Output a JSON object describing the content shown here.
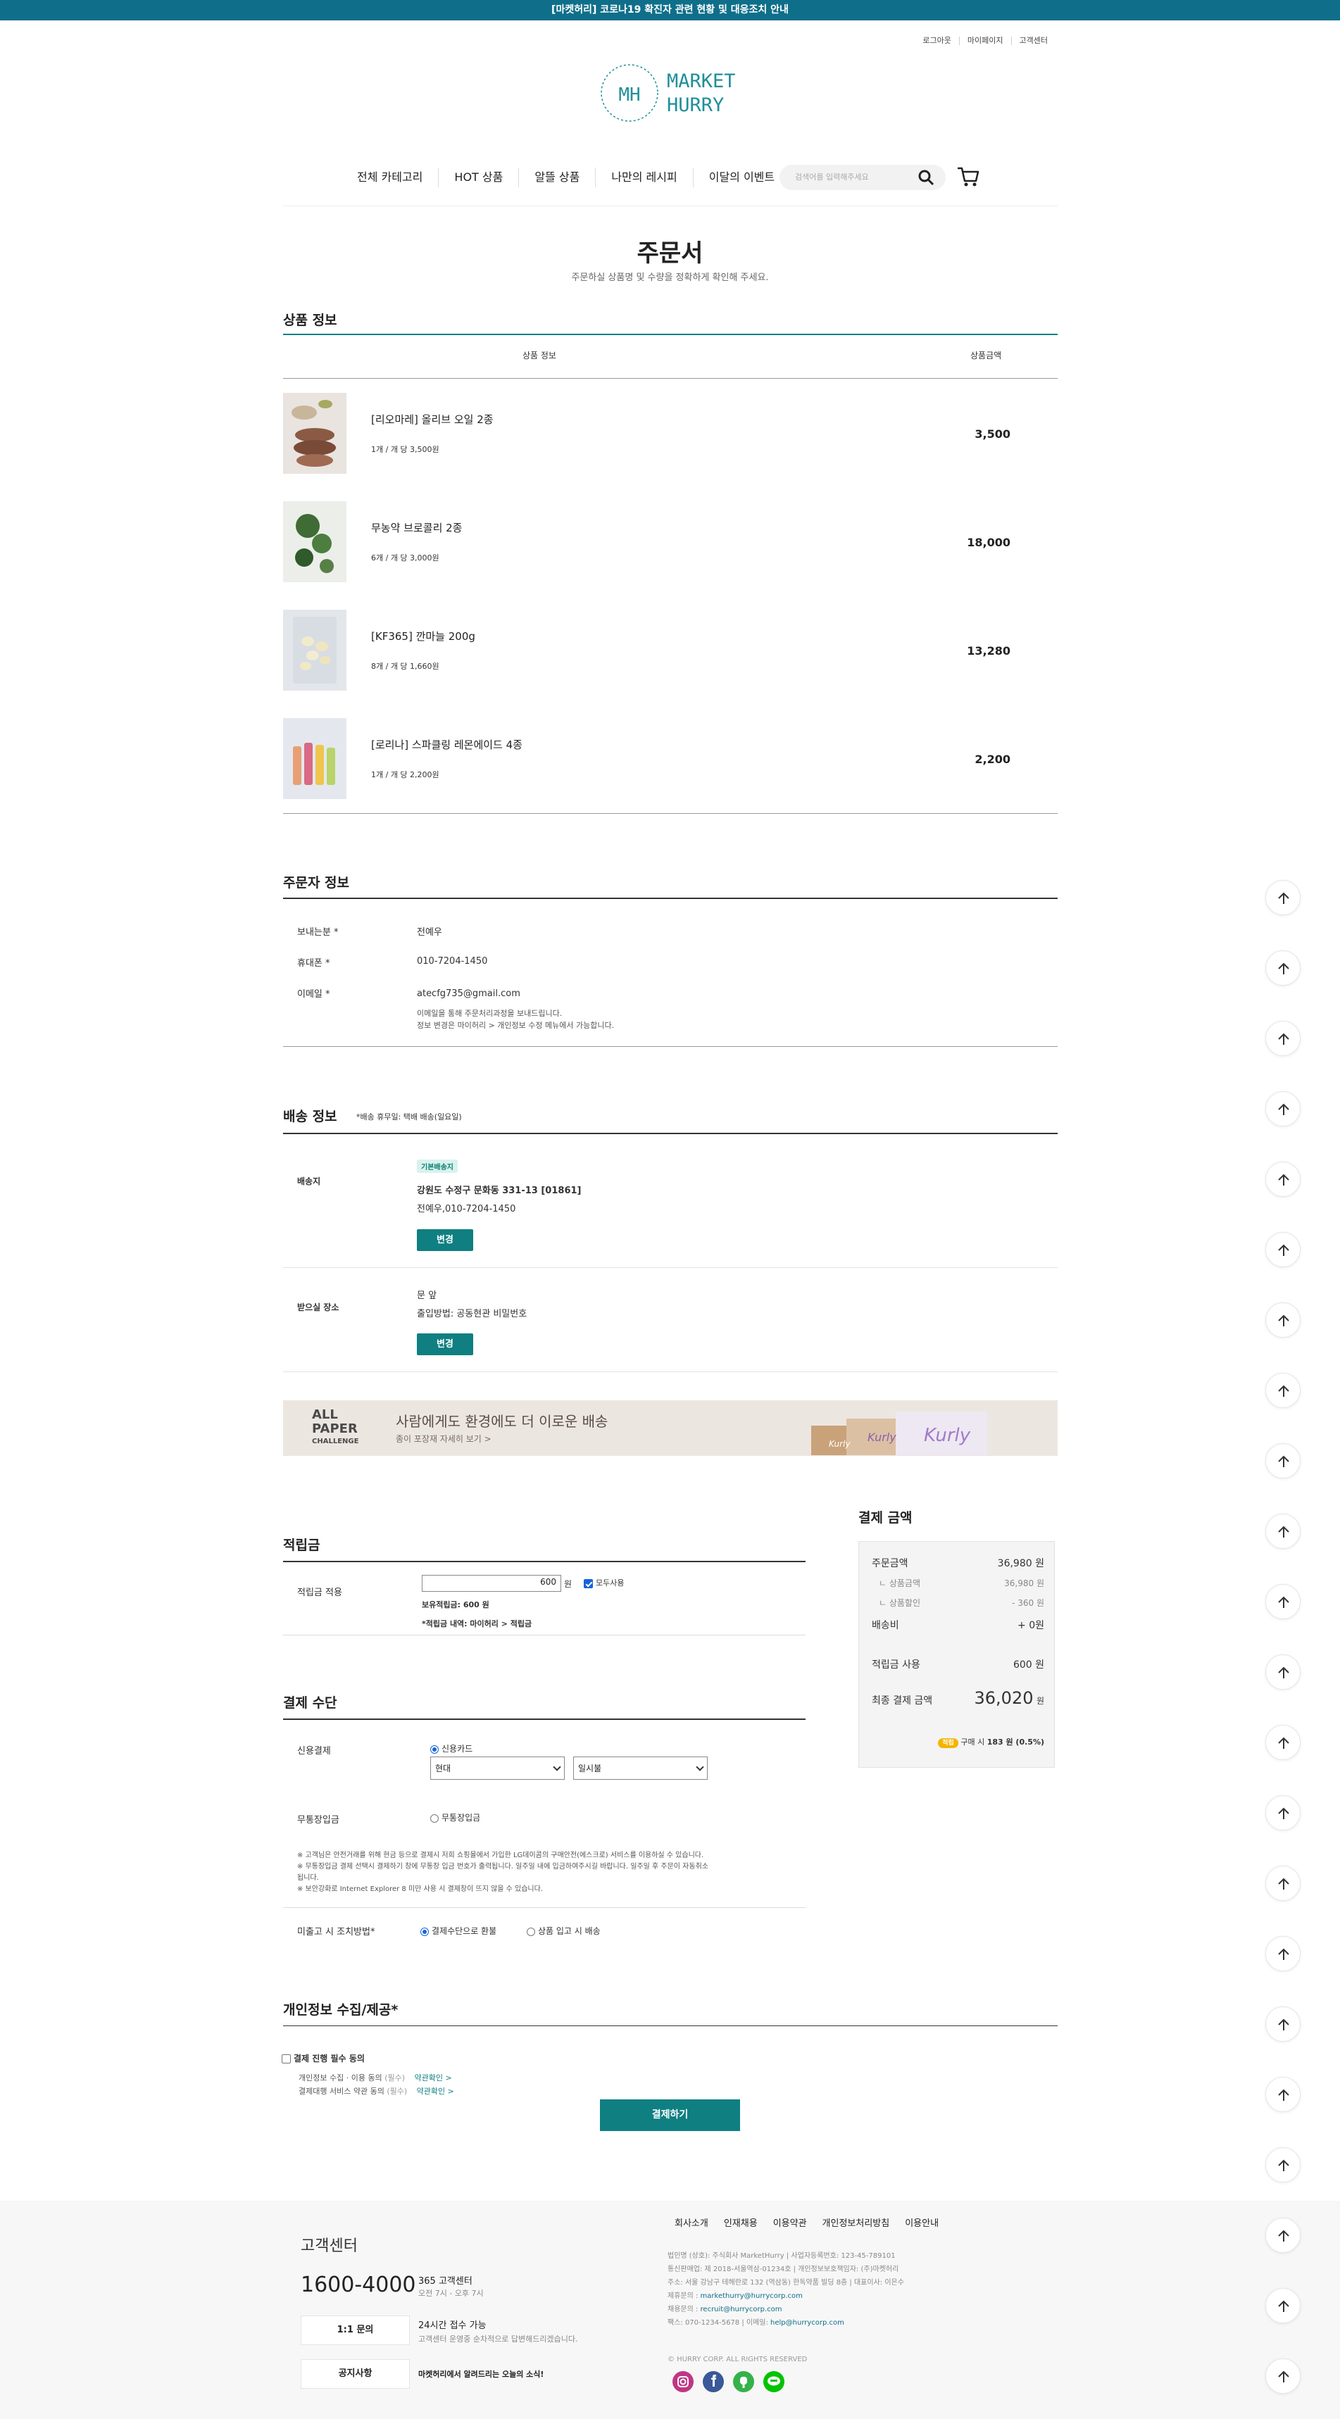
{
  "topbar": {
    "notice": "[마켓허리] 코로나19 확진자 관련 현황 및 대응조치 안내"
  },
  "util": [
    "로그아웃",
    "마이페이지",
    "고객센터"
  ],
  "logo": {
    "initials": "MH",
    "line1": "MARKET",
    "line2": "HURRY"
  },
  "nav": [
    "전체 카테고리",
    "HOT 상품",
    "알뜰 상품",
    "나만의 레시피",
    "이달의 이벤트"
  ],
  "search": {
    "placeholder": "검색어를 입력해주세요"
  },
  "page": {
    "title": "주문서",
    "subtitle": "주문하실 상품명 및 수량을 정확하게 확인해 주세요."
  },
  "products": {
    "title": "상품 정보",
    "col_info": "상품 정보",
    "col_price": "상품금액",
    "items": [
      {
        "name": "[리오마레] 올리브 오일 2종",
        "qty": "1개 / 개 당 3,500원",
        "price": "3,500"
      },
      {
        "name": "무농약 브로콜리 2종",
        "qty": "6개 / 개 당 3,000원",
        "price": "18,000"
      },
      {
        "name": "[KF365] 깐마늘 200g",
        "qty": "8개 / 개 당 1,660원",
        "price": "13,280"
      },
      {
        "name": "[로리나] 스파클링 레몬에이드 4종",
        "qty": "1개 / 개 당 2,200원",
        "price": "2,200"
      }
    ]
  },
  "orderer": {
    "title": "주문자 정보",
    "sender_label": "보내는분 *",
    "sender": "전예우",
    "phone_label": "휴대폰 *",
    "phone": "010-7204-1450",
    "email_label": "이메일 *",
    "email": "atecfg735@gmail.com",
    "email_note1": "이메일을 통해 주문처리과정을 보내드립니다.",
    "email_note2": "정보 변경은 마이허리 > 개인정보 수정 메뉴에서 가능합니다."
  },
  "shipping": {
    "title": "배송 정보",
    "note": "*배송 휴무일: 택배 배송(일요일)",
    "addr_label": "배송지",
    "default_badge": "기본배송지",
    "address": "강원도 수정구 문화동 331-13 [01861]",
    "recipient": "전예우,010-7204-1450",
    "change": "변경",
    "place_label": "받으실 장소",
    "place": "문 앞",
    "entry": "출입방법: 공동현관 비밀번호",
    "change2": "변경"
  },
  "banner": {
    "logo1": "ALL",
    "logo2": "PAPER",
    "logo3": "CHALLENGE",
    "headline": "사람에게도 환경에도 더 이로운 배송",
    "link": "종이 포장재 자세히 보기 >",
    "box_brand": "Kurly"
  },
  "points": {
    "title": "적립금",
    "label": "적립금 적용",
    "value": "600",
    "unit": "원",
    "use_all": "모두사용",
    "owned": "보유적립금: 600 원",
    "history": "*적립금 내역: 마이허리 > 적립금"
  },
  "payment": {
    "title": "결제 수단",
    "card_label": "신용결제",
    "card_option": "신용카드",
    "card_company": "현대",
    "installment": "일시불",
    "bank_label": "무통장입금",
    "bank_option": "무통장입금",
    "notice1": "※ 고객님은 안전거래를 위해 현금 등으로 결제시 저희 쇼핑몰에서 가입한 LG데이콤의 구매안전(에스크로) 서비스를 이용하실 수 있습니다.",
    "notice2": "※ 무통장입금 결제 선택시 결제하기 창에 무통장 입금 번호가 출력됩니다. 일주일 내에 입금하여주시길 바랍니다. 일주일 후 주문이 자동취소",
    "notice3": "됩니다.",
    "notice4": "※ 보안강화로 Internet Explorer 8 미만 사용 시 결제창이 뜨지 않을 수 있습니다.",
    "shortage_label": "미출고 시 조치방법*",
    "refund": "결제수단으로 환불",
    "restock": "상품 입고 시 배송"
  },
  "summary": {
    "title": "결제 금액",
    "order_label": "주문금액",
    "order": "36,980 원",
    "goods_label": "ㄴ 상품금액",
    "goods": "36,980 원",
    "discount_label": "ㄴ 상품할인",
    "discount": "- 360 원",
    "ship_label": "배송비",
    "ship": "+ 0원",
    "points_label": "적립금 사용",
    "points": "600 원",
    "final_label": "최종 결제 금액",
    "final": "36,020",
    "final_unit": "원",
    "earn_badge": "적립",
    "earn_pre": "구매 시",
    "earn": "183 원 (0.5%)"
  },
  "consent": {
    "title": "개인정보 수집/제공*",
    "required": "결제 진행 필수 동의",
    "item1": "개인정보 수집 · 이용 동의",
    "item2": "결제대행 서비스 약관 동의",
    "req_tag": "(필수)",
    "view": "약관확인 >"
  },
  "pay_button": "결제하기",
  "footer": {
    "cs_title": "고객센터",
    "phone": "1600-4000",
    "phone_desc": "365 고객센터",
    "phone_hours": "오전 7시 - 오후 7시",
    "btn1": "1:1 문의",
    "btn1_desc": "24시간 접수 가능",
    "btn1_sub": "고객센터 운영중 순차적으로 답변해드리겠습니다.",
    "btn2": "공지사항",
    "btn2_desc": "마켓허리에서 알려드리는 오늘의 소식!",
    "links": [
      "회사소개",
      "인재채용",
      "이용약관",
      "개인정보처리방침",
      "이용안내"
    ],
    "info1": "법인명 (상호): 주식회사 MarketHurry  |  사업자등록번호: 123-45-789101",
    "info2": "통신판매업: 제 2018-서울역삼-01234호  |  개인정보보호책임자: (주)마켓허리",
    "info3": "주소: 서울 강남구 테헤란로 132 (역삼동) 한독약품 빌딩 8층  |  대표이사: 이은수",
    "info4_label": "제휴문의 : ",
    "info4": "markethurry@hurrycorp.com",
    "info5_label": "채용문의 : ",
    "info5": "recruit@hurrycorp.com",
    "info6": "팩스: 070-1234-5678  |  이메일: ",
    "info6_mail": "help@hurrycorp.com",
    "copyright": "© HURRY CORP. ALL RIGHTS RESERVED"
  },
  "colors": {
    "teal": "#0f7f82",
    "topbar": "#0f6f8a",
    "instagram": "#c13584",
    "facebook": "#3b5998",
    "blog": "#35b24a",
    "line": "#00c300"
  },
  "icons": [
    "search-icon",
    "cart-icon",
    "arrow-up-icon",
    "instagram-icon",
    "facebook-icon",
    "blog-icon",
    "line-icon"
  ]
}
